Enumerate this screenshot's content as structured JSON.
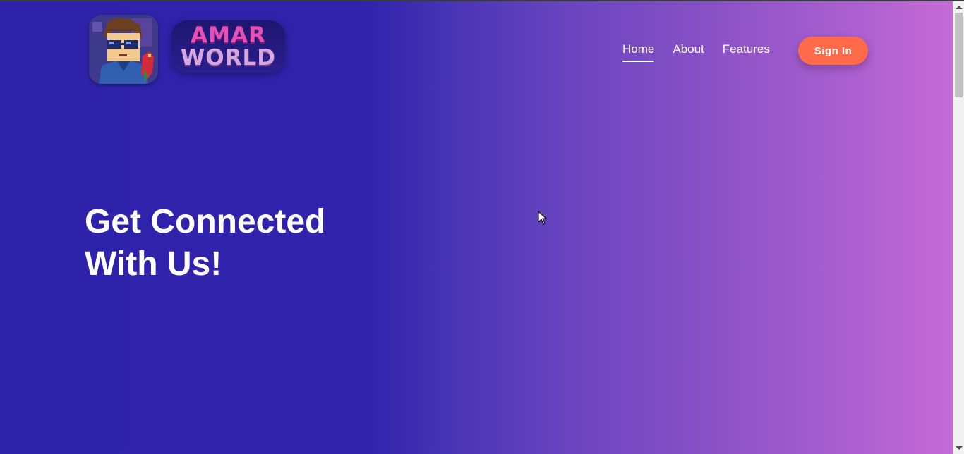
{
  "header": {
    "logo_text_line1": "AMAR",
    "logo_text_line2": "WORLD",
    "nav": [
      {
        "label": "Home",
        "active": true
      },
      {
        "label": "About",
        "active": false
      },
      {
        "label": "Features",
        "active": false
      }
    ],
    "signin_label": "Sign In"
  },
  "hero": {
    "title_line1": "Get Connected",
    "title_line2": "With Us!"
  },
  "colors": {
    "gradient_start": "#2f22aa",
    "gradient_end": "#c56ad6",
    "button": "#ff6b4a",
    "logo_pink": "#e84fb4",
    "logo_lilac": "#d8a6de"
  }
}
